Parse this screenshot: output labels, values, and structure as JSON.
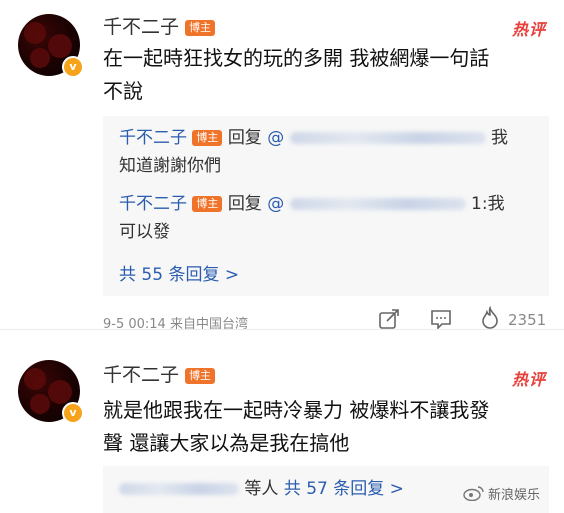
{
  "comments": [
    {
      "username": "千不二子",
      "tag": "博主",
      "hot_label": "热评",
      "body_line1": "在一起時狂找女的玩的多開 我被網爆一句話",
      "body_line2": "不說",
      "replies": [
        {
          "user": "千不二子",
          "tag": "博主",
          "reply_word": "回复",
          "at": "@",
          "end_char": "我",
          "line2": "知道謝謝你們"
        },
        {
          "user": "千不二子",
          "tag": "博主",
          "reply_word": "回复",
          "at": "@",
          "end_char": "1:我",
          "line2": "可以發"
        }
      ],
      "more_replies": "共 55 条回复 >",
      "meta": "9-5 00:14  来自中国台湾",
      "like_count": "2351"
    },
    {
      "username": "千不二子",
      "tag": "博主",
      "hot_label": "热评",
      "body_line1": "就是他跟我在一起時冷暴力 被爆料不讓我發",
      "body_line2": "聲 還讓大家以為是我在搞他",
      "replies_suffix": "等人",
      "more_replies": "共 57 条回复 >"
    }
  ],
  "watermark": "新浪娱乐",
  "colors": {
    "accent_link": "#2a5db0",
    "tag_bg": "#f0732a",
    "hot": "#e8403b",
    "reply_bg": "#f7f7f7"
  },
  "icons": [
    "verified-badge-icon",
    "share-icon",
    "comment-icon",
    "like-icon",
    "weibo-watermark-icon"
  ]
}
